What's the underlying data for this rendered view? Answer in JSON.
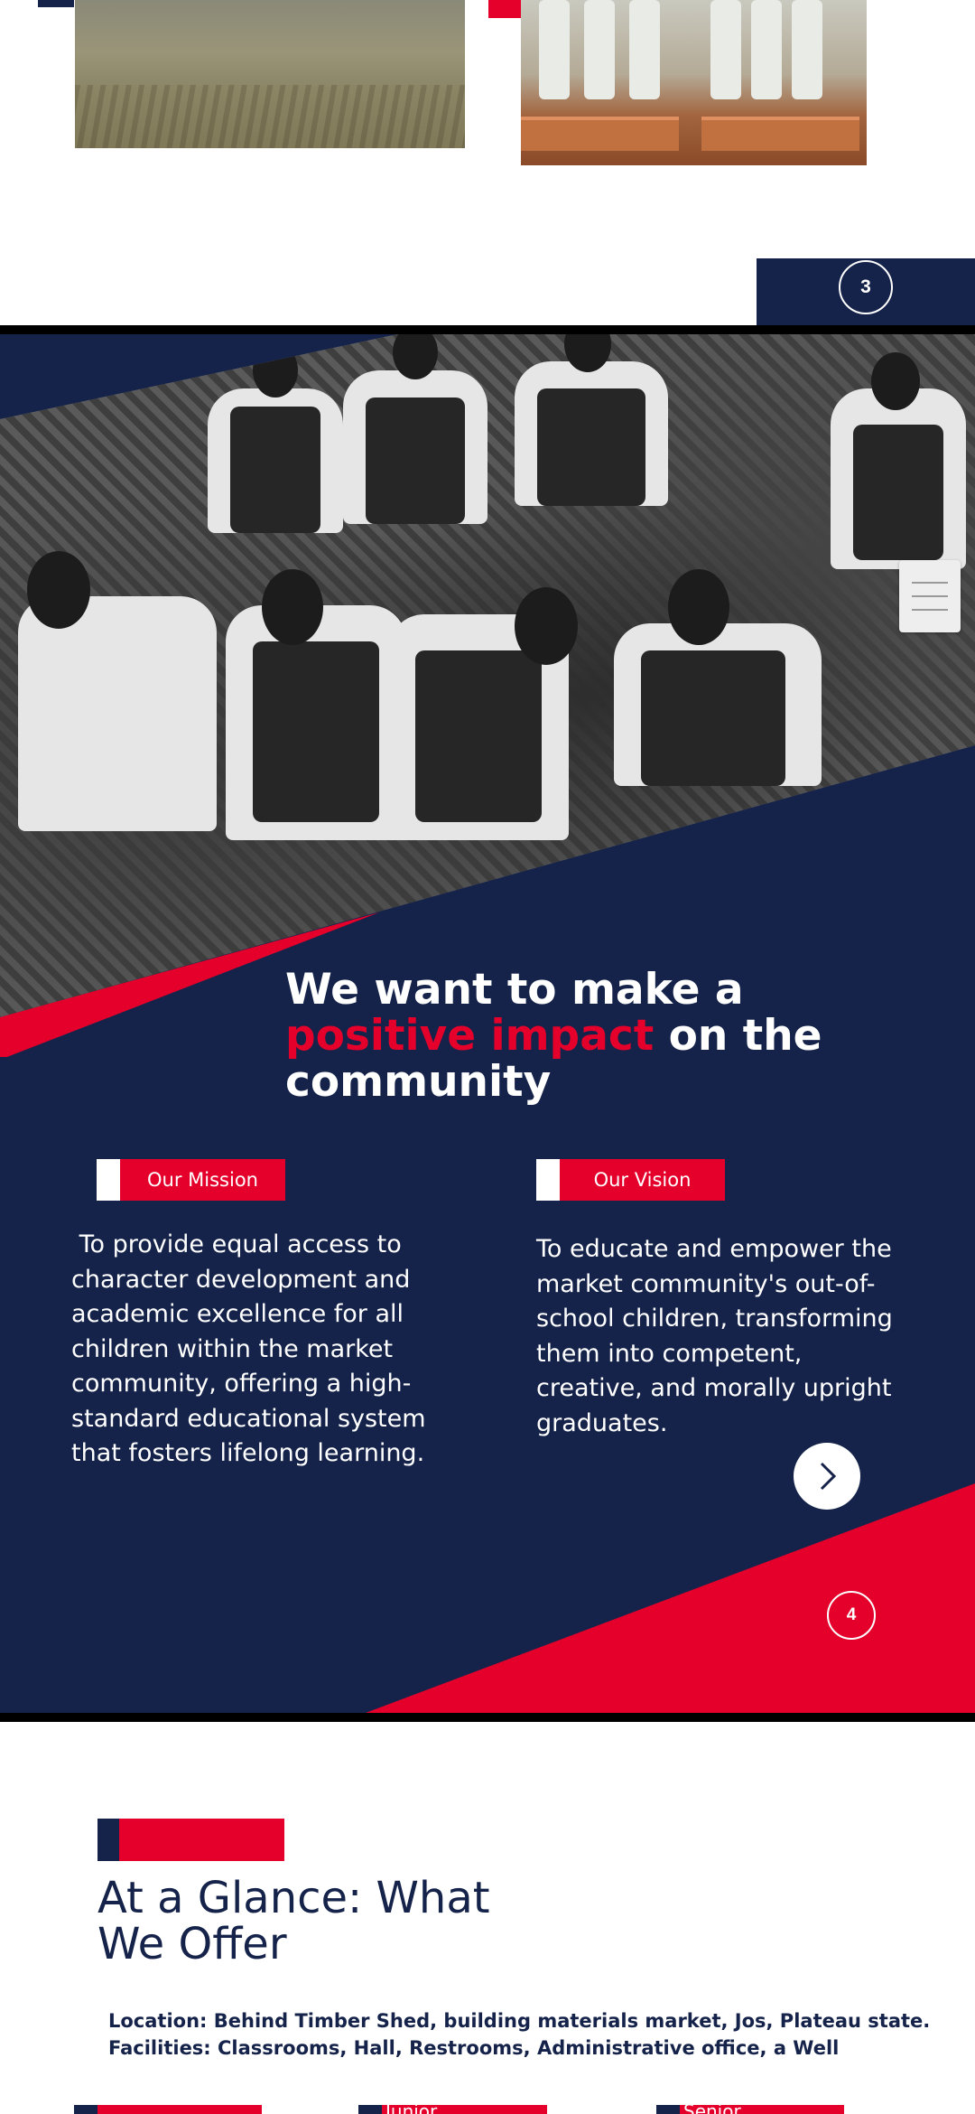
{
  "slide_markers": {
    "previous": "3",
    "current": "4"
  },
  "mission_slide": {
    "headline": {
      "line1": "We want to make a",
      "highlight": "positive impact",
      "rest": " on the",
      "line3": "community"
    },
    "mission": {
      "label": "Our Mission",
      "text": " To provide equal access to\ncharacter development and\nacademic excellence for all\nchildren within the market\ncommunity, offering a high-\nstandard educational system\nthat fosters lifelong learning."
    },
    "vision": {
      "label": "Our Vision",
      "text": "To educate and empower the\nmarket community's out-of-\nschool children, transforming\nthem into competent,\ncreative, and morally upright\ngraduates."
    },
    "next_button_icon": "chevron-right-icon",
    "menu_icon": "hamburger-menu-icon"
  },
  "glance": {
    "title_line1": "At a Glance: What",
    "title_line2": "We Offer",
    "location": "Location: Behind Timber Shed, building materials market, Jos, Plateau state.",
    "facilities": "Facilities: Classrooms, Hall, Restrooms, Administrative office,  a Well",
    "cards": [
      {
        "label": ""
      },
      {
        "label": "Junior"
      },
      {
        "label": "Senior"
      }
    ]
  },
  "colors": {
    "navy": "#15234a",
    "red": "#e4002b",
    "white": "#ffffff"
  }
}
